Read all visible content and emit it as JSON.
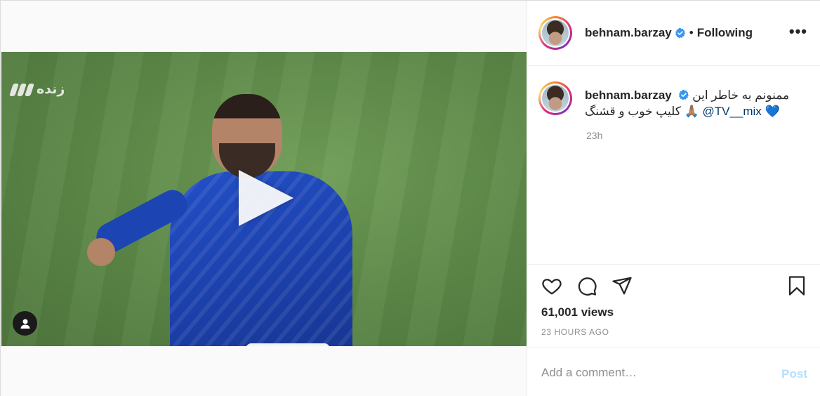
{
  "video": {
    "channel_logo_text": "زنده"
  },
  "header": {
    "username": "behnam.barzay",
    "separator": "•",
    "follow_status": "Following",
    "more_label": "•••"
  },
  "caption": {
    "username": "behnam.barzay",
    "text_line1": "ممنونم به خاطر این",
    "text_line2": "کلیپ خوب و قشنگ 🙏🏽",
    "mention": "@TV__mix",
    "emoji": "💙",
    "time": "23h"
  },
  "stats": {
    "views": "61,001 views",
    "posted": "23 HOURS AGO"
  },
  "comment": {
    "placeholder": "Add a comment…",
    "post_label": "Post"
  },
  "colors": {
    "verified": "#3897f0",
    "link": "#00376b",
    "post_disabled": "#b2dffc",
    "secondary_text": "#8e8e8e"
  },
  "icons": [
    "play-icon",
    "user-tag-icon",
    "verified-badge-icon",
    "more-options-icon",
    "heart-icon",
    "comment-icon",
    "share-icon",
    "bookmark-icon"
  ]
}
